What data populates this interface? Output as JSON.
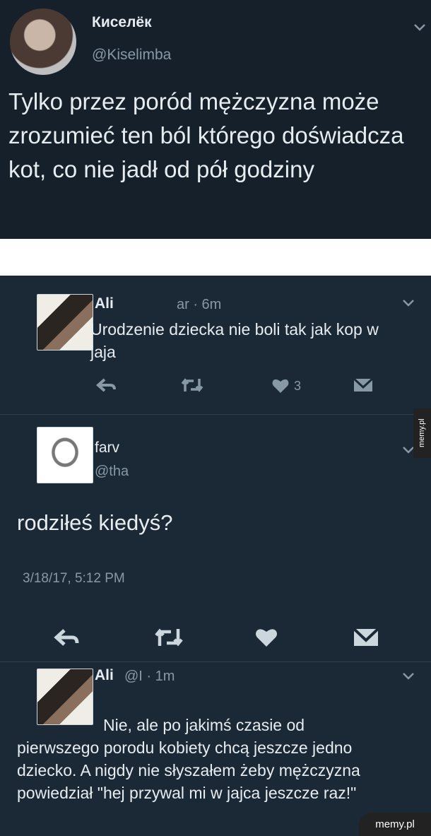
{
  "top_tweet": {
    "name": "Киселёк",
    "handle": "@Kiselimba",
    "text": "Tylko przez poród mężczyzna może zrozumieć ten ból którego doświadcza kot, co nie jadł od pół godziny"
  },
  "thread": {
    "tweet1": {
      "name": "Ali",
      "meta": "ar · 6m",
      "text": "Urodzenie dziecka nie boli tak jak kop w jaja",
      "like_count": "3"
    },
    "tweet2": {
      "name": "farv",
      "handle": "@tha",
      "text": "rodziłeś kiedyś?",
      "date": "3/18/17, 5:12 PM"
    },
    "tweet3": {
      "name": "Ali",
      "meta": "@I · 1m",
      "text_line1": "Nie, ale po jakimś czasie od",
      "text_rest": "pierwszego porodu kobiety chcą jeszcze jedno dziecko. A nigdy nie słyszałem żeby mężczyzna powiedział \"hej przywal mi w jajca jeszcze raz!\""
    }
  },
  "watermarks": {
    "side": "memy.pl",
    "bottom": "memy.pl"
  },
  "icons": {
    "reply": "reply-icon",
    "retweet": "retweet-icon",
    "like": "heart-icon",
    "dm": "envelope-icon",
    "more": "chevron-down-icon"
  },
  "colors": {
    "top_bg": "#15202b",
    "thread_bg": "#1b2836",
    "text": "#e6ecf0",
    "muted": "#8899a6"
  }
}
